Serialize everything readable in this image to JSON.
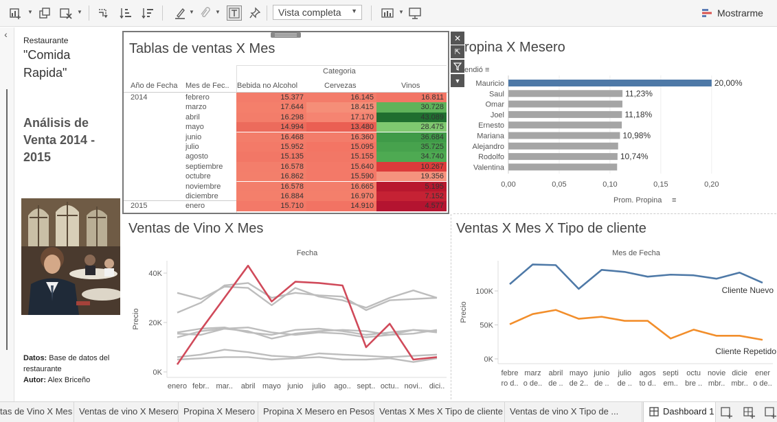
{
  "toolbar": {
    "view_select": "Vista completa",
    "show_me": "Mostrarme",
    "icons": [
      "new-worksheet-icon",
      "duplicate-icon",
      "clear-sheet-icon",
      "swap-axes-icon",
      "sort-ascending-icon",
      "sort-descending-icon",
      "highlight-icon",
      "group-icon",
      "label-icon",
      "pin-icon",
      "chart-type-icon",
      "presentation-icon"
    ]
  },
  "left_panel": {
    "restaurant_label": "Restaurante",
    "restaurant_name_1": "\"Comida",
    "restaurant_name_2": "Rapida\"",
    "analysis_1": "Análisis de",
    "analysis_2": "Venta 2014 -",
    "analysis_3": "2015",
    "datos_label": "Datos:",
    "datos_value_1": "Base de datos del",
    "datos_value_2": "restaurante",
    "autor_label": "Autor:",
    "autor_value": "Alex Briceño"
  },
  "crosstab": {
    "title": "Tablas de ventas X Mes",
    "category_header": "Categoria",
    "col_year": "Año de Fecha",
    "col_month": "Mes de Fec..",
    "cols": [
      "Bebida no Alcohol",
      "Cervezas",
      "Vinos"
    ],
    "rows": [
      {
        "year": "2014",
        "month": "febrero",
        "values": [
          "15.377",
          "16.145",
          "16.811"
        ],
        "colors": [
          "#f37c6a",
          "#f37c6a",
          "#f27565"
        ]
      },
      {
        "year": "",
        "month": "marzo",
        "values": [
          "17.644",
          "18.415",
          "30.728"
        ],
        "colors": [
          "#f47f6b",
          "#f58e78",
          "#5fb35a"
        ]
      },
      {
        "year": "",
        "month": "abril",
        "values": [
          "16.298",
          "17.170",
          "43.089"
        ],
        "colors": [
          "#f37d6a",
          "#f58471",
          "#1f6e2f"
        ]
      },
      {
        "year": "",
        "month": "mayo",
        "values": [
          "14.994",
          "13.480",
          "28.475"
        ],
        "colors": [
          "#ec6b5c",
          "#ea5f53",
          "#7fc870"
        ]
      },
      {
        "year": "",
        "month": "junio",
        "values": [
          "16.468",
          "16.360",
          "36.684"
        ],
        "colors": [
          "#f37d6a",
          "#f37c6a",
          "#3f9a48"
        ]
      },
      {
        "year": "",
        "month": "julio",
        "values": [
          "15.952",
          "15.095",
          "35.725"
        ],
        "colors": [
          "#f37a68",
          "#f37564",
          "#47a24d"
        ]
      },
      {
        "year": "",
        "month": "agosto",
        "values": [
          "15.135",
          "15.155",
          "34.740"
        ],
        "colors": [
          "#f27766",
          "#f27766",
          "#4eaa52"
        ]
      },
      {
        "year": "",
        "month": "septiembre",
        "values": [
          "16.578",
          "15.640",
          "10.267"
        ],
        "colors": [
          "#f37e6b",
          "#f37968",
          "#dc3b3b"
        ]
      },
      {
        "year": "",
        "month": "octubre",
        "values": [
          "16.862",
          "15.590",
          "19.356"
        ],
        "colors": [
          "#f37f6b",
          "#f37968",
          "#f5937e"
        ]
      },
      {
        "year": "",
        "month": "noviembre",
        "values": [
          "16.578",
          "16.665",
          "5.195"
        ],
        "colors": [
          "#f37e6b",
          "#f37e6b",
          "#b8182e"
        ]
      },
      {
        "year": "",
        "month": "diciembre",
        "values": [
          "16.884",
          "16.970",
          "7.152"
        ],
        "colors": [
          "#f47f6b",
          "#f47f6b",
          "#c52234"
        ]
      },
      {
        "year": "2015",
        "month": "enero",
        "values": [
          "15.710",
          "14.910",
          "4.577"
        ],
        "colors": [
          "#f37968",
          "#f27363",
          "#b41430"
        ]
      }
    ]
  },
  "propina": {
    "title": "Propina X Mesero",
    "title_visible": "ropina X Mesero",
    "dim_header": "endió",
    "axis_title": "Prom. Propina",
    "ticks": [
      "0,00",
      "0,05",
      "0,10",
      "0,15",
      "0,20"
    ]
  },
  "vino": {
    "title": "Ventas de Vino X Mes",
    "header": "Fecha",
    "ylabel": "Precio",
    "yticks": [
      "40K",
      "20K",
      "0K"
    ],
    "xticks": [
      "enero",
      "febr..",
      "mar..",
      "abril",
      "mayo",
      "junio",
      "julio",
      "ago..",
      "sept..",
      "octu..",
      "novi..",
      "dici.."
    ]
  },
  "cliente": {
    "title": "Ventas X Mes X Tipo de cliente",
    "header": "Mes de Fecha",
    "ylabel": "Precio",
    "yticks": [
      "100K",
      "50K",
      "0K"
    ],
    "xticks1": [
      "febre",
      "marz",
      "abril",
      "mayo",
      "junio",
      "julio",
      "agos",
      "septi",
      "octu",
      "novie",
      "dicie",
      "ener"
    ],
    "xticks2": [
      "ro d..",
      "o de..",
      "de ..",
      "de 2..",
      "de ..",
      "de ..",
      "to d..",
      "em..",
      "bre ..",
      "mbr..",
      "mbr..",
      "o de.."
    ],
    "label_nuevo": "Cliente Nuevo",
    "label_repetido": "Cliente Repetido"
  },
  "tabs": [
    "tas de Vino X Mes",
    "Ventas de vino X Mesero",
    "Propina X Mesero",
    "Propina X Mesero en Pesos",
    "Ventas X Mes X Tipo de cliente",
    "Ventas de vino X Tipo de ...",
    "Dashboard 1"
  ],
  "chart_data": [
    {
      "type": "bar",
      "title": "Propina X Mesero",
      "xlabel": "Prom. Propina",
      "categories": [
        "Mauricio",
        "Saul",
        "Omar",
        "Joel",
        "Ernesto",
        "Mariana",
        "Alejandro",
        "Rodolfo",
        "Valentina"
      ],
      "values": [
        0.2,
        0.1123,
        0.1122,
        0.1118,
        0.1116,
        0.1098,
        0.108,
        0.1074,
        0.107
      ],
      "data_labels": [
        "20,00%",
        "11,23%",
        "",
        "11,18%",
        "",
        "10,98%",
        "",
        "10,74%",
        ""
      ],
      "colors": [
        "#4e79a7",
        "#a5a5a5",
        "#a5a5a5",
        "#a5a5a5",
        "#a5a5a5",
        "#a5a5a5",
        "#a5a5a5",
        "#a5a5a5",
        "#a5a5a5"
      ],
      "xlim": [
        0,
        0.24
      ]
    },
    {
      "type": "line",
      "title": "Ventas de Vino X Mes",
      "ylabel": "Precio",
      "categories": [
        "enero",
        "febr..",
        "mar..",
        "abril",
        "mayo",
        "junio",
        "julio",
        "ago..",
        "sept..",
        "octu..",
        "novi..",
        "dici.."
      ],
      "ylim": [
        0,
        48000
      ],
      "series": [
        {
          "color": "#d04a5a",
          "values": [
            3000,
            17000,
            30000,
            43000,
            28500,
            36500,
            36000,
            35000,
            10000,
            19500,
            5000,
            6000
          ]
        },
        {
          "color": "#bdbdbd",
          "values": [
            24000,
            28000,
            35000,
            36000,
            30000,
            32000,
            31000,
            30500,
            25000,
            29000,
            29500,
            30000
          ]
        },
        {
          "color": "#bdbdbd",
          "values": [
            32000,
            29500,
            34500,
            34000,
            27000,
            34000,
            30500,
            29000,
            26000,
            30000,
            33000,
            30000
          ]
        },
        {
          "color": "#bdbdbd",
          "values": [
            16000,
            17500,
            18000,
            16000,
            15000,
            17000,
            17500,
            16500,
            15000,
            16000,
            17000,
            16000
          ]
        },
        {
          "color": "#bdbdbd",
          "values": [
            14000,
            16500,
            17500,
            18000,
            16000,
            15000,
            16000,
            15500,
            14000,
            15000,
            15500,
            17000
          ]
        },
        {
          "color": "#bdbdbd",
          "values": [
            15500,
            15000,
            17500,
            16500,
            13500,
            15500,
            16500,
            17000,
            16500,
            15000,
            17000,
            16500
          ]
        },
        {
          "color": "#bdbdbd",
          "values": [
            6000,
            7000,
            9000,
            8000,
            6500,
            6000,
            7500,
            7000,
            6500,
            6000,
            6500,
            7000
          ]
        },
        {
          "color": "#bdbdbd",
          "values": [
            5000,
            5500,
            6000,
            6000,
            5000,
            5500,
            6000,
            5000,
            5000,
            5500,
            4000,
            5500
          ]
        }
      ]
    },
    {
      "type": "line",
      "title": "Ventas X Mes X Tipo de cliente",
      "ylabel": "Precio",
      "categories": [
        "febrero",
        "marzo",
        "abril",
        "mayo",
        "junio",
        "julio",
        "agosto",
        "septiembre",
        "octubre",
        "noviembre",
        "diciembre",
        "enero"
      ],
      "ylim": [
        0,
        150000
      ],
      "series": [
        {
          "name": "Cliente Nuevo",
          "color": "#4e79a7",
          "values": [
            110000,
            139000,
            138000,
            103000,
            131000,
            128000,
            121000,
            124000,
            123000,
            118000,
            127000,
            112000
          ]
        },
        {
          "name": "Cliente Repetido",
          "color": "#f28e2b",
          "values": [
            51000,
            66000,
            72000,
            59000,
            62000,
            56000,
            56000,
            30000,
            43000,
            34000,
            34000,
            28000
          ]
        }
      ]
    }
  ]
}
